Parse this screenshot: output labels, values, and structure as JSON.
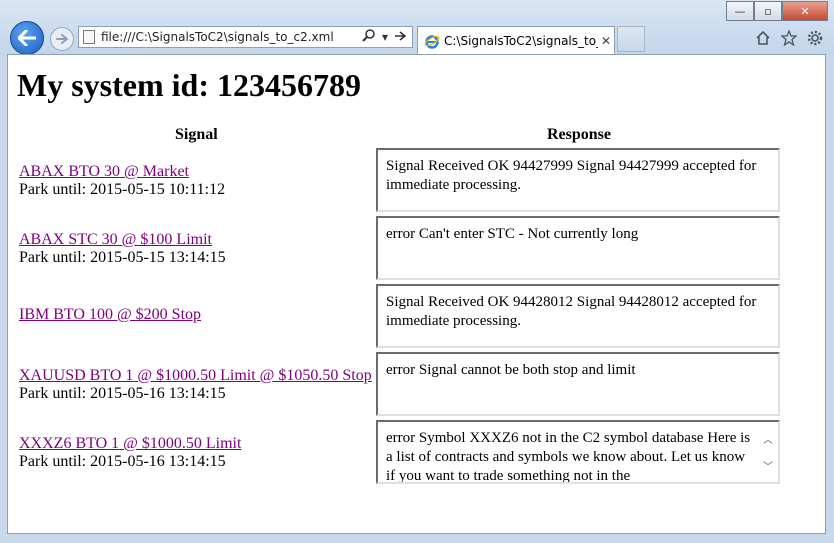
{
  "browser": {
    "address_url": "file:///C:\\SignalsToC2\\signals_to_c2.xml",
    "tab_title": "C:\\SignalsToC2\\signals_to_...",
    "window_buttons": {
      "minimize": "—",
      "maximize": "▫",
      "close": "✕"
    }
  },
  "page": {
    "title": "My system id: 123456789",
    "col_signal": "Signal",
    "col_response": "Response"
  },
  "rows": [
    {
      "signal": "ABAX BTO 30 @ Market",
      "park": "Park until: 2015-05-15 10:11:12",
      "response": "Signal Received OK 94427999 Signal 94427999 accepted for immediate processing."
    },
    {
      "signal": "ABAX STC 30 @ $100 Limit",
      "park": "Park until: 2015-05-15 13:14:15",
      "response": "error Can't enter STC - Not currently long"
    },
    {
      "signal": "IBM BTO 100 @ $200 Stop",
      "park": "",
      "response": "Signal Received OK 94428012 Signal 94428012 accepted for immediate processing."
    },
    {
      "signal": "XAUUSD BTO 1 @ $1000.50 Limit @ $1050.50 Stop",
      "park": "Park until: 2015-05-16 13:14:15",
      "response": "error Signal cannot be both stop and limit"
    },
    {
      "signal": "XXXZ6 BTO 1 @ $1000.50 Limit",
      "park": "Park until: 2015-05-16 13:14:15",
      "response": "error Symbol XXXZ6 not in the C2 symbol database Here is a list of contracts and symbols we know about. Let us know if you want to trade something not in the"
    }
  ]
}
